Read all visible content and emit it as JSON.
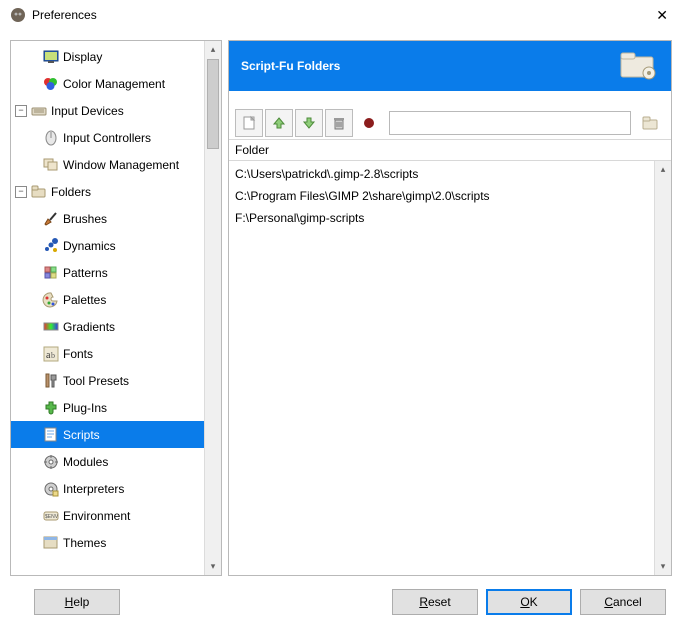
{
  "window": {
    "title": "Preferences"
  },
  "tree": {
    "items": [
      {
        "name": "display",
        "label": "Display",
        "depth": 1,
        "exp": ""
      },
      {
        "name": "colormgmt",
        "label": "Color Management",
        "depth": 1,
        "exp": ""
      },
      {
        "name": "inputdev",
        "label": "Input Devices",
        "depth": 0,
        "exp": "-"
      },
      {
        "name": "inputctrl",
        "label": "Input Controllers",
        "depth": 1,
        "exp": ""
      },
      {
        "name": "windowmgmt",
        "label": "Window Management",
        "depth": 1,
        "exp": ""
      },
      {
        "name": "folders",
        "label": "Folders",
        "depth": 0,
        "exp": "-"
      },
      {
        "name": "brushes",
        "label": "Brushes",
        "depth": 1,
        "exp": ""
      },
      {
        "name": "dynamics",
        "label": "Dynamics",
        "depth": 1,
        "exp": ""
      },
      {
        "name": "patterns",
        "label": "Patterns",
        "depth": 1,
        "exp": ""
      },
      {
        "name": "palettes",
        "label": "Palettes",
        "depth": 1,
        "exp": ""
      },
      {
        "name": "gradients",
        "label": "Gradients",
        "depth": 1,
        "exp": ""
      },
      {
        "name": "fonts",
        "label": "Fonts",
        "depth": 1,
        "exp": ""
      },
      {
        "name": "toolpresets",
        "label": "Tool Presets",
        "depth": 1,
        "exp": ""
      },
      {
        "name": "plugins",
        "label": "Plug-Ins",
        "depth": 1,
        "exp": ""
      },
      {
        "name": "scripts",
        "label": "Scripts",
        "depth": 1,
        "exp": "",
        "selected": true
      },
      {
        "name": "modules",
        "label": "Modules",
        "depth": 1,
        "exp": ""
      },
      {
        "name": "interp",
        "label": "Interpreters",
        "depth": 1,
        "exp": ""
      },
      {
        "name": "env",
        "label": "Environment",
        "depth": 1,
        "exp": ""
      },
      {
        "name": "themes",
        "label": "Themes",
        "depth": 1,
        "exp": ""
      }
    ]
  },
  "banner": {
    "title": "Script-Fu Folders"
  },
  "toolbar": {
    "path_value": ""
  },
  "folders": {
    "header": "Folder",
    "rows": [
      "C:\\Users\\patrickd\\.gimp-2.8\\scripts",
      "C:\\Program Files\\GIMP 2\\share\\gimp\\2.0\\scripts",
      "F:\\Personal\\gimp-scripts"
    ]
  },
  "buttons": {
    "help": "Help",
    "reset": "Reset",
    "ok": "OK",
    "cancel": "Cancel"
  }
}
